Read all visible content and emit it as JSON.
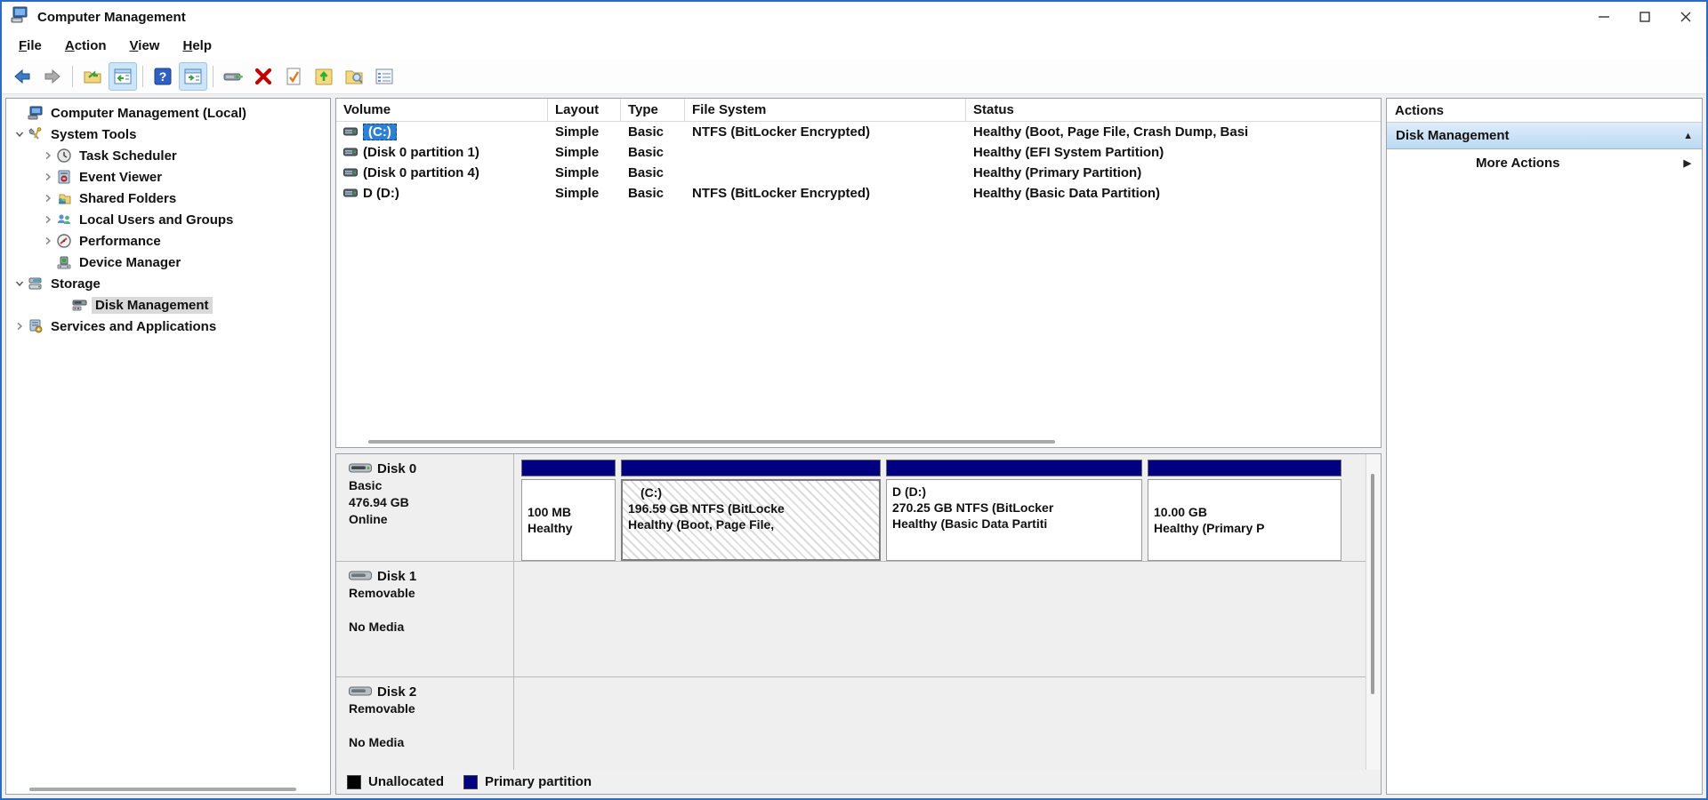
{
  "window": {
    "title": "Computer Management"
  },
  "menu": {
    "items": [
      "File",
      "Action",
      "View",
      "Help"
    ]
  },
  "toolbar": {
    "icons": [
      "back",
      "forward",
      "show-console-tree-folder",
      "console-tree-toggle",
      "help",
      "action-pane-toggle",
      "remote-computer",
      "delete",
      "mark-partition-active",
      "folder-up",
      "folder-view",
      "properties-checklist"
    ]
  },
  "tree": {
    "items": [
      {
        "label": "Computer Management (Local)"
      },
      {
        "label": "System Tools"
      },
      {
        "label": "Task Scheduler"
      },
      {
        "label": "Event Viewer"
      },
      {
        "label": "Shared Folders"
      },
      {
        "label": "Local Users and Groups"
      },
      {
        "label": "Performance"
      },
      {
        "label": "Device Manager"
      },
      {
        "label": "Storage"
      },
      {
        "label": "Disk Management"
      },
      {
        "label": "Services and Applications"
      }
    ]
  },
  "volumes": {
    "columns": [
      "Volume",
      "Layout",
      "Type",
      "File System",
      "Status"
    ],
    "rows": [
      {
        "name": "(C:)",
        "layout": "Simple",
        "type": "Basic",
        "fs": "NTFS (BitLocker Encrypted)",
        "status": "Healthy (Boot, Page File, Crash Dump, Basi"
      },
      {
        "name": "(Disk 0 partition 1)",
        "layout": "Simple",
        "type": "Basic",
        "fs": "",
        "status": "Healthy (EFI System Partition)"
      },
      {
        "name": "(Disk 0 partition 4)",
        "layout": "Simple",
        "type": "Basic",
        "fs": "",
        "status": "Healthy (Primary Partition)"
      },
      {
        "name": "D (D:)",
        "layout": "Simple",
        "type": "Basic",
        "fs": "NTFS (BitLocker Encrypted)",
        "status": "Healthy (Basic Data Partition)"
      }
    ]
  },
  "disks": [
    {
      "name": "Disk 0",
      "kind": "Basic",
      "size": "476.94 GB",
      "status": "Online",
      "partitions": [
        {
          "title": "",
          "line1": "100 MB",
          "line2": "Healthy"
        },
        {
          "title": "(C:)",
          "line1": "196.59 GB NTFS (BitLocke",
          "line2": "Healthy (Boot, Page File,"
        },
        {
          "title": "D  (D:)",
          "line1": "270.25 GB NTFS (BitLocker",
          "line2": "Healthy (Basic Data Partiti"
        },
        {
          "title": "",
          "line1": "10.00 GB",
          "line2": "Healthy (Primary P"
        }
      ]
    },
    {
      "name": "Disk 1",
      "kind": "Removable",
      "status": "No Media"
    },
    {
      "name": "Disk 2",
      "kind": "Removable",
      "status": "No Media"
    }
  ],
  "legend": [
    {
      "label": "Unallocated",
      "color": "#000000"
    },
    {
      "label": "Primary partition",
      "color": "#000080"
    }
  ],
  "actions": {
    "header": "Actions",
    "group": "Disk Management",
    "more": "More Actions"
  },
  "colors": {
    "selection": "#2e80d7",
    "partition_primary": "#000080",
    "window_border": "#2b6cc3"
  }
}
